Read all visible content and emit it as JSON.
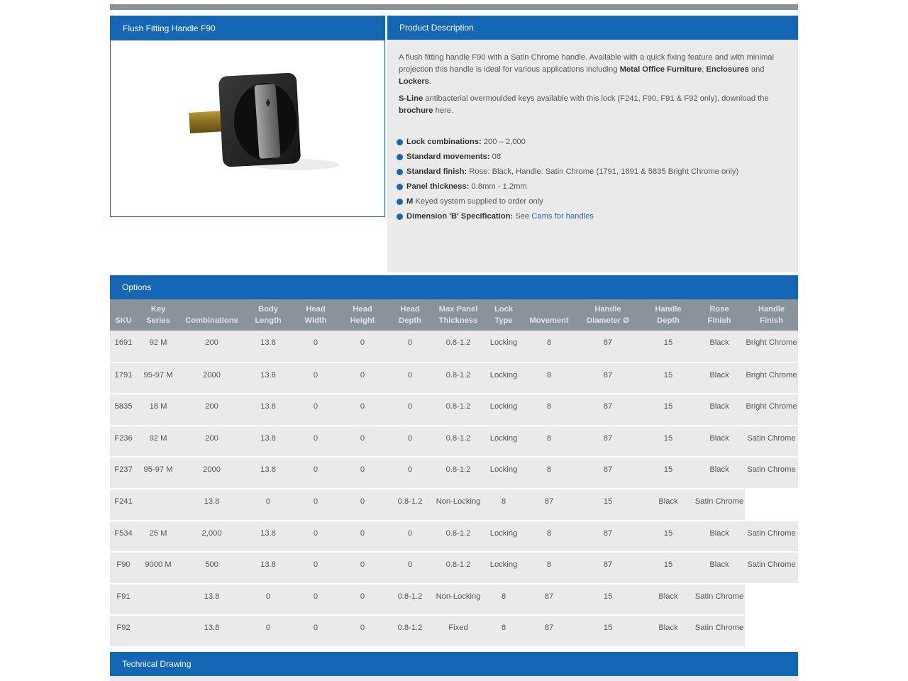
{
  "product": {
    "title": "Flush Fitting Handle F90",
    "image": "flush-handle-photo"
  },
  "description": {
    "title": "Product Description",
    "p1": [
      {
        "t": "A flush fitting handle F90 with a Satin Chrome handle. Available with a quick fixing feature and with minimal projection this handle is ideal for various applications including ",
        "b": false
      },
      {
        "t": "Metal Office Furniture",
        "b": true
      },
      {
        "t": ", ",
        "b": false
      },
      {
        "t": "Enclosures",
        "b": true
      },
      {
        "t": " and ",
        "b": false
      },
      {
        "t": "Lockers",
        "b": true
      },
      {
        "t": ".",
        "b": false
      }
    ],
    "p2": [
      {
        "t": "S-Line",
        "b": true
      },
      {
        "t": " antibacterial overmoulded keys available with this lock (F241, F90, F91 & F92 only), download the ",
        "b": false
      },
      {
        "t": "brochure",
        "b": true
      },
      {
        "t": " here.",
        "b": false
      }
    ],
    "bullets": [
      {
        "label": "Lock combinations:",
        "value": " 200 – 2,000"
      },
      {
        "label": "Standard movements:",
        "value": " 08"
      },
      {
        "label": "Standard finish:",
        "value": " Rose: Black, Handle: Satin Chrome (1791, 1691 & 5835 Bright Chrome only)"
      },
      {
        "label": "Panel thickness:",
        "value": " 0.8mm - 1.2mm"
      },
      {
        "label": "M",
        "value": " Keyed system supplied to order only"
      },
      {
        "label": "Dimension 'B' Specification:",
        "value": " See ",
        "link": "Cams for handles"
      }
    ]
  },
  "options": {
    "title": "Options",
    "headers": [
      [
        "",
        "SKU"
      ],
      [
        "Key",
        "Series"
      ],
      [
        "",
        "Combinations"
      ],
      [
        "Body",
        "Length"
      ],
      [
        "Head",
        "Width"
      ],
      [
        "Head",
        "Height"
      ],
      [
        "Head",
        "Depth"
      ],
      [
        "Max Panel",
        "Thickness"
      ],
      [
        "Lock",
        "Type"
      ],
      [
        "",
        "Movement"
      ],
      [
        "Handle",
        "Diameter Ø"
      ],
      [
        "Handle",
        "Depth"
      ],
      [
        "Rose",
        "Finish"
      ],
      [
        "Handle",
        "Finish"
      ]
    ],
    "rows": [
      [
        "1691",
        "92 M",
        "200",
        "13.8",
        "0",
        "0",
        "0",
        "0.8-1.2",
        "Locking",
        "8",
        "87",
        "15",
        "Black",
        "Bright Chrome"
      ],
      [
        "1791",
        "95-97 M",
        "2000",
        "13.8",
        "0",
        "0",
        "0",
        "0.8-1.2",
        "Locking",
        "8",
        "87",
        "15",
        "Black",
        "Bright Chrome"
      ],
      [
        "5835",
        "18 M",
        "200",
        "13.8",
        "0",
        "0",
        "0",
        "0.8-1.2",
        "Locking",
        "8",
        "87",
        "15",
        "Black",
        "Bright Chrome"
      ],
      [
        "F236",
        "92 M",
        "200",
        "13.8",
        "0",
        "0",
        "0",
        "0.8-1.2",
        "Locking",
        "8",
        "87",
        "15",
        "Black",
        "Satin Chrome"
      ],
      [
        "F237",
        "95-97 M",
        "2000",
        "13.8",
        "0",
        "0",
        "0",
        "0.8-1.2",
        "Locking",
        "8",
        "87",
        "15",
        "Black",
        "Satin Chrome"
      ],
      [
        "F241",
        "",
        "13.8",
        "0",
        "0",
        "0",
        "0.8-1.2",
        "Non-Locking",
        "8",
        "87",
        "15",
        "Black",
        "Satin Chrome",
        null
      ],
      [
        "F534",
        "25 M",
        "2,000",
        "13.8",
        "0",
        "0",
        "0",
        "0.8-1.2",
        "Locking",
        "8",
        "87",
        "15",
        "Black",
        "Satin Chrome"
      ],
      [
        "F90",
        "9000 M",
        "500",
        "13.8",
        "0",
        "0",
        "0",
        "0.8-1.2",
        "Locking",
        "8",
        "87",
        "15",
        "Black",
        "Satin Chrome"
      ],
      [
        "F91",
        "",
        "13.8",
        "0",
        "0",
        "0",
        "0.8-1.2",
        "Non-Locking",
        "8",
        "87",
        "15",
        "Black",
        "Satin Chrome",
        null
      ],
      [
        "F92",
        "",
        "13.8",
        "0",
        "0",
        "0",
        "0.8-1.2",
        "Fixed",
        "8",
        "87",
        "15",
        "Black",
        "Satin Chrome",
        null
      ]
    ]
  },
  "technical": {
    "title": "Technical Drawing"
  },
  "colors": {
    "header_blue": "#1367b5",
    "header_gray": "#8a9399",
    "panel_gray": "#eaeaea"
  }
}
